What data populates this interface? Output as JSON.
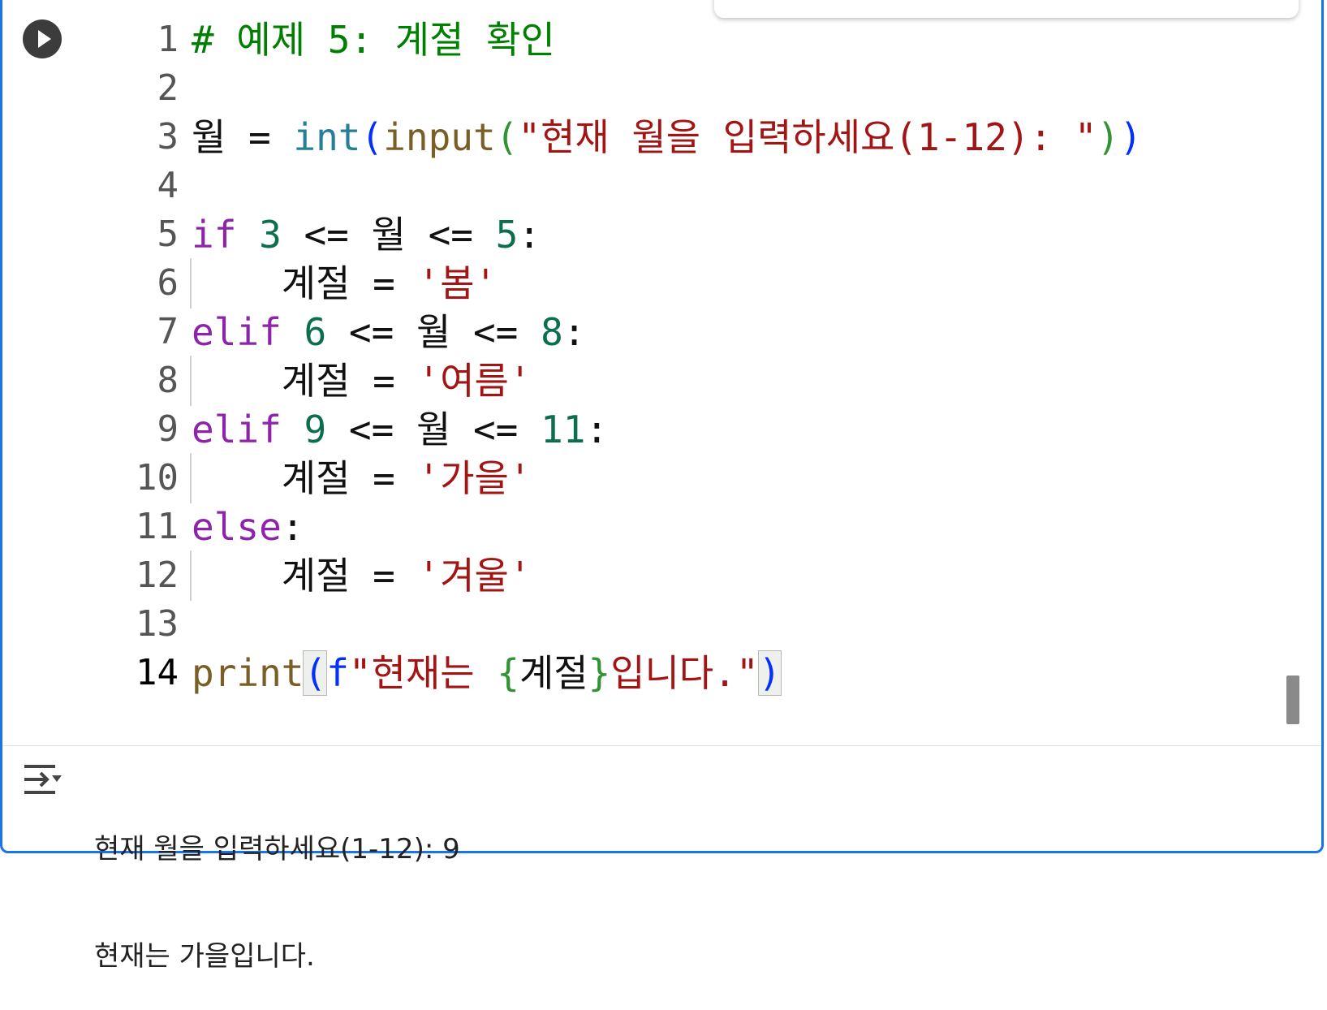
{
  "editor": {
    "lines": [
      {
        "num": "1",
        "tokens": [
          {
            "t": "# 예제 5: 계절 확인",
            "c": "t-comment"
          }
        ]
      },
      {
        "num": "2",
        "tokens": []
      },
      {
        "num": "3",
        "tokens": [
          {
            "t": "월 = ",
            "c": "t-op"
          },
          {
            "t": "int",
            "c": "t-builtin"
          },
          {
            "t": "(",
            "c": "t-paren-blue"
          },
          {
            "t": "input",
            "c": "t-fn"
          },
          {
            "t": "(",
            "c": "t-paren-green"
          },
          {
            "t": "\"현재 월을 입력하세요(1-12): \"",
            "c": "t-str"
          },
          {
            "t": ")",
            "c": "t-paren-green"
          },
          {
            "t": ")",
            "c": "t-paren-blue"
          }
        ]
      },
      {
        "num": "4",
        "tokens": []
      },
      {
        "num": "5",
        "tokens": [
          {
            "t": "if",
            "c": "t-kw"
          },
          {
            "t": " ",
            "c": "t-op"
          },
          {
            "t": "3",
            "c": "t-num"
          },
          {
            "t": " <= 월 <= ",
            "c": "t-op"
          },
          {
            "t": "5",
            "c": "t-num"
          },
          {
            "t": ":",
            "c": "t-op"
          }
        ]
      },
      {
        "num": "6",
        "indent": true,
        "tokens": [
          {
            "t": "    계절 = ",
            "c": "t-op"
          },
          {
            "t": "'봄'",
            "c": "t-str"
          }
        ]
      },
      {
        "num": "7",
        "tokens": [
          {
            "t": "elif",
            "c": "t-kw"
          },
          {
            "t": " ",
            "c": "t-op"
          },
          {
            "t": "6",
            "c": "t-num"
          },
          {
            "t": " <= 월 <= ",
            "c": "t-op"
          },
          {
            "t": "8",
            "c": "t-num"
          },
          {
            "t": ":",
            "c": "t-op"
          }
        ]
      },
      {
        "num": "8",
        "indent": true,
        "tokens": [
          {
            "t": "    계절 = ",
            "c": "t-op"
          },
          {
            "t": "'여름'",
            "c": "t-str"
          }
        ]
      },
      {
        "num": "9",
        "tokens": [
          {
            "t": "elif",
            "c": "t-kw"
          },
          {
            "t": " ",
            "c": "t-op"
          },
          {
            "t": "9",
            "c": "t-num"
          },
          {
            "t": " <= 월 <= ",
            "c": "t-op"
          },
          {
            "t": "11",
            "c": "t-num"
          },
          {
            "t": ":",
            "c": "t-op"
          }
        ]
      },
      {
        "num": "10",
        "indent": true,
        "tokens": [
          {
            "t": "    계절 = ",
            "c": "t-op"
          },
          {
            "t": "'가을'",
            "c": "t-str"
          }
        ]
      },
      {
        "num": "11",
        "tokens": [
          {
            "t": "else",
            "c": "t-kw"
          },
          {
            "t": ":",
            "c": "t-op"
          }
        ]
      },
      {
        "num": "12",
        "indent": true,
        "tokens": [
          {
            "t": "    계절 = ",
            "c": "t-op"
          },
          {
            "t": "'겨울'",
            "c": "t-str"
          }
        ]
      },
      {
        "num": "13",
        "tokens": []
      },
      {
        "num": "14",
        "active": true,
        "tokens": [
          {
            "t": "print",
            "c": "t-fn"
          },
          {
            "t": "(",
            "c": "t-paren-blue bracket-match"
          },
          {
            "t": "f",
            "c": "t-paren-blue"
          },
          {
            "t": "\"현재는 ",
            "c": "t-str"
          },
          {
            "t": "{",
            "c": "t-brace"
          },
          {
            "t": "계절",
            "c": "t-op"
          },
          {
            "t": "}",
            "c": "t-brace"
          },
          {
            "t": "입니다.\"",
            "c": "t-str"
          },
          {
            "t": ")",
            "c": "t-paren-blue bracket-match"
          }
        ]
      }
    ]
  },
  "output": {
    "line1": "현재 월을 입력하세요(1-12): 9",
    "line2": "현재는 가을입니다."
  },
  "icons": {
    "run": "play-circle-icon",
    "output": "output-toggle-icon"
  },
  "colors": {
    "cell_border": "#1a73e8",
    "comment": "#008000",
    "keyword": "#8e24aa",
    "number": "#0b6e4f",
    "string": "#a31515"
  }
}
